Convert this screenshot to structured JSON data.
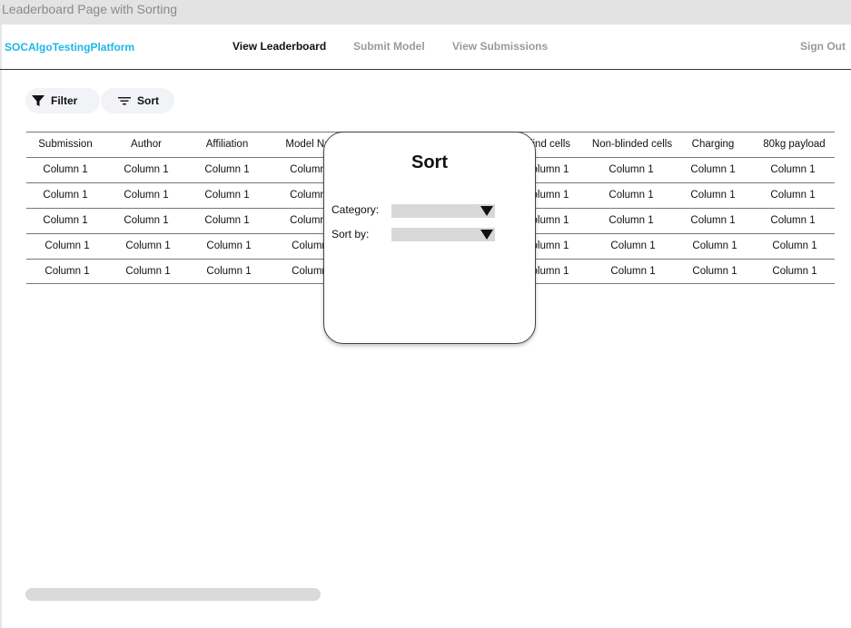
{
  "frame": {
    "title": "Leaderboard Page with Sorting"
  },
  "nav": {
    "brand": "SOCAlgoTestingPlatform",
    "links": [
      "View Leaderboard",
      "Submit Model",
      "View Submissions"
    ],
    "sign_out": "Sign Out"
  },
  "toolbar": {
    "filter_label": "Filter",
    "sort_label": "Sort"
  },
  "table": {
    "headers": [
      "Submission",
      "Author",
      "Affiliation",
      "Model Na",
      "lind cells",
      "Non-blinded cells",
      "Charging",
      "80kg payload"
    ],
    "rows": [
      [
        "Column 1",
        "Column 1",
        "Column 1",
        "Column",
        "olumn 1",
        "Column 1",
        "Column 1",
        "Column 1"
      ],
      [
        "Column 1",
        "Column 1",
        "Column 1",
        "Column",
        "olumn 1",
        "Column 1",
        "Column 1",
        "Column 1"
      ],
      [
        "Column 1",
        "Column 1",
        "Column 1",
        "Column",
        "olumn 1",
        "Column 1",
        "Column 1",
        "Column 1"
      ],
      [
        "Column 1",
        "Column 1",
        "Column 1",
        "Column",
        "olumn 1",
        "Column 1",
        "Column 1",
        "Column 1"
      ],
      [
        "Column 1",
        "Column 1",
        "Column 1",
        "Column",
        "olumn 1",
        "Column 1",
        "Column 1",
        "Column 1"
      ]
    ]
  },
  "sort_modal": {
    "title": "Sort",
    "category_label": "Category:",
    "category_value": "",
    "sort_by_label": "Sort by:",
    "sort_by_value": ""
  },
  "colors": {
    "brand": "#1fb6e8",
    "muted": "#9a9a9a"
  },
  "icons": {
    "filter": "funnel-icon",
    "sort": "sort-lines-icon",
    "dropdown": "triangle-down-icon"
  }
}
